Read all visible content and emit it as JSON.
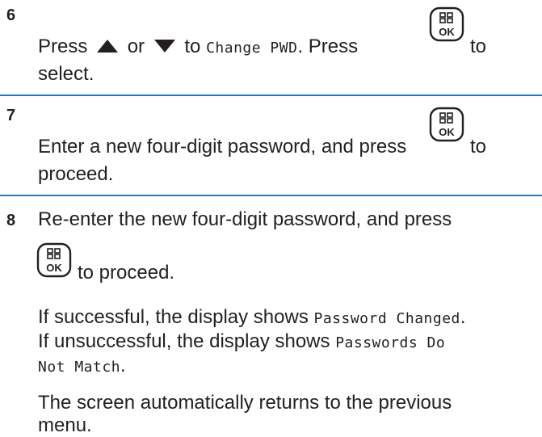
{
  "steps": [
    {
      "number": "6",
      "line1_pre": "Press",
      "line1_or": "or",
      "line1_to": "to",
      "line1_mono": "Change PWD",
      "line1_post": ". Press",
      "line1_end": "to",
      "line2": "select."
    },
    {
      "number": "7",
      "line1": "Enter a new four-digit password, and press",
      "line1_end": "to",
      "line2": "proceed."
    },
    {
      "number": "8",
      "line1": "Re-enter the new four-digit password, and press",
      "line2": "to proceed.",
      "result_pre1": "If successful, the display shows",
      "result_mono1": "Password Changed",
      "result_post1": ".",
      "result_pre2": "If unsuccessful, the display shows",
      "result_mono2a": "Passwords Do",
      "result_mono2b": "Not Match",
      "result_post2": ".",
      "final1": "The screen automatically returns to the previous",
      "final2": "menu."
    }
  ],
  "icons": {
    "up": "up-arrow-icon",
    "down": "down-arrow-icon",
    "ok": "menu-ok-key-icon",
    "ok_label": "OK"
  }
}
